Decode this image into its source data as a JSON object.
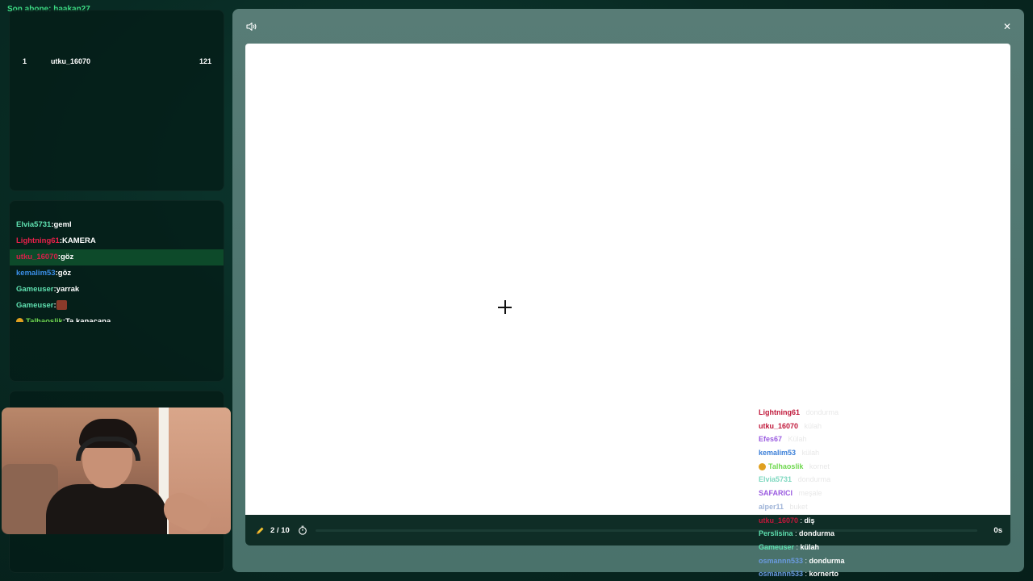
{
  "sub_banner": "Son abone: haakan27",
  "leaderboard": [
    {
      "rank": "1",
      "name": "utku_16070",
      "score": "121"
    }
  ],
  "chat": [
    {
      "user": "Elvia5731",
      "color": "#5fe0b0",
      "sep": ":",
      "text": "geml"
    },
    {
      "user": "Lightning61",
      "color": "#e8204a",
      "sep": ":",
      "text": "KAMERA"
    },
    {
      "user": "utku_16070",
      "color": "#d6204a",
      "sep": ":",
      "text": "göz",
      "highlight": true
    },
    {
      "user": "kemalim53",
      "color": "#3b8fe8",
      "sep": ":",
      "text": "göz"
    },
    {
      "user": "Gameuser",
      "color": "#5fe0b0",
      "sep": ":",
      "text": "yarrak"
    },
    {
      "user": "Gameuser",
      "color": "#5fe0b0",
      "sep": ":",
      "text": "",
      "emote": "image-emote"
    },
    {
      "user": "Talhaoslik",
      "color": "#70d850",
      "sep": ":",
      "text": "Ta kanacana",
      "badge": "face-emoji"
    }
  ],
  "game": {
    "round": "2 / 10",
    "time": "0s",
    "progress": 0,
    "sound_icon": "speaker-icon",
    "close_icon": "close-icon"
  },
  "guesses": [
    {
      "user": "Lightning61",
      "color": "#c0183a",
      "sep": " : ",
      "word": "dondurma",
      "light": true
    },
    {
      "user": "utku_16070",
      "color": "#c0183a",
      "sep": " : ",
      "word": "külah",
      "light": true
    },
    {
      "user": "Efes67",
      "color": "#9b5ce0",
      "sep": " : ",
      "word": "Külah",
      "light": true
    },
    {
      "user": "kemalim53",
      "color": "#3b7fd8",
      "sep": " : ",
      "word": "külah",
      "light": true
    },
    {
      "user": "Talhaoslik",
      "color": "#70d850",
      "sep": " : ",
      "word": "kornet",
      "light": true,
      "badge": true
    },
    {
      "user": "Elvia5731",
      "color": "#7fd8c0",
      "sep": " : ",
      "word": "dondurma",
      "light": true
    },
    {
      "user": "SAFARICI",
      "color": "#9b5ce0",
      "sep": " : ",
      "word": "meşale",
      "light": true
    },
    {
      "user": "alper11",
      "color": "#9fb4d8",
      "sep": " : ",
      "word": "buket",
      "light": true
    },
    {
      "user": "utku_16070",
      "color": "#c0183a",
      "sep": " : ",
      "word": "diş",
      "light": false
    },
    {
      "user": "Perslisina",
      "color": "#5fe0b0",
      "sep": " : ",
      "word": "dondurma",
      "light": false
    },
    {
      "user": "Gameuser",
      "color": "#5fe0b0",
      "sep": " : ",
      "word": "külah",
      "light": false
    },
    {
      "user": "osmannn533",
      "color": "#6a9ae0",
      "sep": " : ",
      "word": "dondurma",
      "light": false
    },
    {
      "user": "osmannn533",
      "color": "#6a9ae0",
      "sep": " : ",
      "word": "kornerto",
      "light": false
    }
  ]
}
